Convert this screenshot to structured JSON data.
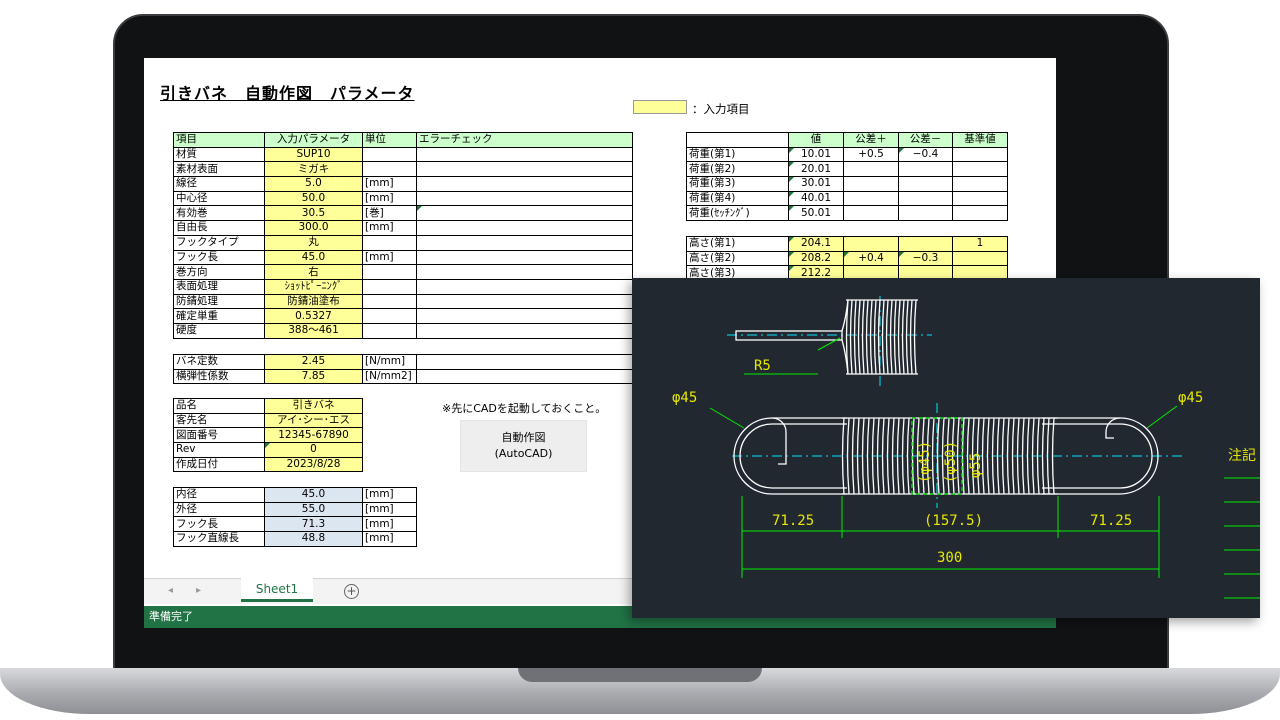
{
  "sheet": {
    "title": "引きバネ　自動作図　パラメータ",
    "legend_label": "：入力項目"
  },
  "params_table": {
    "headers": [
      "項目",
      "入力パラメータ",
      "単位",
      "エラーチェック"
    ],
    "rows": [
      [
        "材質",
        "SUP10",
        "",
        ""
      ],
      [
        "素材表面",
        "ミガキ",
        "",
        ""
      ],
      [
        "線径",
        "5.0",
        "[mm]",
        ""
      ],
      [
        "中心径",
        "50.0",
        "[mm]",
        ""
      ],
      [
        "有効巻",
        "30.5",
        "[巻]",
        ""
      ],
      [
        "自由長",
        "300.0",
        "[mm]",
        ""
      ],
      [
        "フックタイプ",
        "丸",
        "",
        ""
      ],
      [
        "フック長",
        "45.0",
        "[mm]",
        ""
      ],
      [
        "巻方向",
        "右",
        "",
        ""
      ],
      [
        "表面処理",
        "ｼｮｯﾄﾋﾟｰﾆﾝｸﾞ",
        "",
        ""
      ],
      [
        "防錆処理",
        "防錆油塗布",
        "",
        ""
      ],
      [
        "確定単重",
        "0.5327",
        "",
        ""
      ],
      [
        "硬度",
        "388～461",
        "",
        ""
      ]
    ]
  },
  "const_table": {
    "rows": [
      [
        "バネ定数",
        "2.45",
        "[N/mm]",
        ""
      ],
      [
        "横弾性係数",
        "7.85",
        "[N/mm2]",
        ""
      ]
    ]
  },
  "info_table": {
    "rows": [
      [
        "品名",
        "引きバネ"
      ],
      [
        "客先名",
        "アイ･シー･エス"
      ],
      [
        "図面番号",
        "12345-67890"
      ],
      [
        "Rev",
        "0"
      ],
      [
        "作成日付",
        "2023/8/28"
      ]
    ]
  },
  "dim_table": {
    "rows": [
      [
        "内径",
        "45.0",
        "[mm]"
      ],
      [
        "外径",
        "55.0",
        "[mm]"
      ],
      [
        "フック長",
        "71.3",
        "[mm]"
      ],
      [
        "フック直線長",
        "48.8",
        "[mm]"
      ]
    ]
  },
  "load_table": {
    "headers": [
      "",
      "値",
      "公差＋",
      "公差－",
      "基準値"
    ],
    "rows": [
      [
        "荷重(第1)",
        "10.01",
        "+0.5",
        "−0.4",
        ""
      ],
      [
        "荷重(第2)",
        "20.01",
        "",
        "",
        ""
      ],
      [
        "荷重(第3)",
        "30.01",
        "",
        "",
        ""
      ],
      [
        "荷重(第4)",
        "40.01",
        "",
        "",
        ""
      ],
      [
        "荷重(ｾｯﾁﾝｸﾞ)",
        "50.01",
        "",
        "",
        ""
      ]
    ]
  },
  "height_table": {
    "rows": [
      [
        "高さ(第1)",
        "204.1",
        "",
        "",
        "1"
      ],
      [
        "高さ(第2)",
        "208.2",
        "+0.4",
        "−0.3",
        ""
      ],
      [
        "高さ(第3)",
        "212.2",
        "",
        "",
        ""
      ]
    ]
  },
  "note": "※先にCADを起動しておくこと。",
  "macro_button": {
    "line1": "自動作図",
    "line2": "(AutoCAD)"
  },
  "tabs": {
    "prev": "◂",
    "next": "▸",
    "sheet": "Sheet1",
    "add": "+"
  },
  "status": "準備完了",
  "cad": {
    "label_r5": "R5",
    "label_phi45_left": "φ45",
    "label_phi45_right": "φ45",
    "label_inner": "(φ45)",
    "label_mid": "(φ50)",
    "label_outer": "φ55",
    "label_left_len": "71.25",
    "label_center_len": "(157.5)",
    "label_right_len": "71.25",
    "label_total": "300",
    "label_note": "注記",
    "colors": {
      "background": "#212830",
      "outline": "#ffffff",
      "dimension": "#00ee00",
      "centerline": "#00e5ff",
      "text": "#e8e800"
    }
  }
}
